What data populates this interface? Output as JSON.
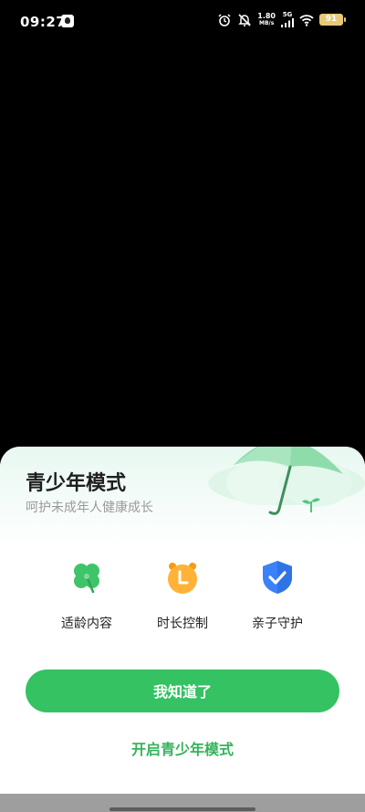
{
  "status_bar": {
    "time": "09:27",
    "net_speed_value": "1.80",
    "net_speed_unit": "MB/s",
    "network": "5G",
    "battery": "91",
    "icons": [
      "app-notification-icon",
      "alarm-icon",
      "mute-bell-icon",
      "signal-icon",
      "wifi-icon",
      "battery-icon"
    ]
  },
  "sheet": {
    "title": "青少年模式",
    "subtitle": "呵护未成年人健康成长",
    "features": [
      {
        "label": "适龄内容",
        "icon": "clover-icon",
        "color": "#3fc46a"
      },
      {
        "label": "时长控制",
        "icon": "alarm-clock-icon",
        "color": "#ffb238"
      },
      {
        "label": "亲子守护",
        "icon": "shield-check-icon",
        "color": "#3a82f7"
      }
    ],
    "primary_button": "我知道了",
    "link_button": "开启青少年模式"
  },
  "colors": {
    "accent": "#35c262",
    "link": "#35b35b",
    "backdrop": "#000000"
  }
}
